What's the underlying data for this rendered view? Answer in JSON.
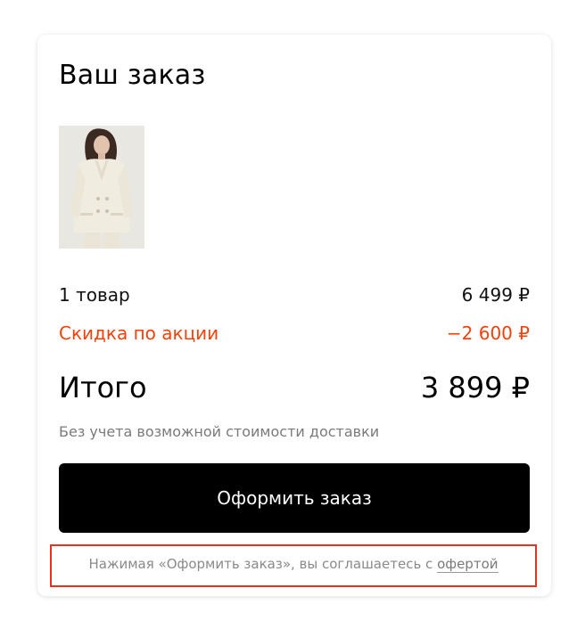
{
  "order": {
    "title": "Ваш заказ",
    "product_image_alt": "coat-photo",
    "items_label": "1 товар",
    "items_price": "6 499 ₽",
    "discount_label": "Скидка по акции",
    "discount_value": "−2 600 ₽",
    "total_label": "Итого",
    "total_value": "3 899 ₽",
    "delivery_note": "Без учета возможной стоимости доставки",
    "checkout_button": "Оформить заказ",
    "consent_text": "Нажимая «Оформить заказ», вы соглашаетесь с ",
    "offer_link": "офертой"
  },
  "colors": {
    "discount": "#f2410a",
    "button_bg": "#000000",
    "highlight_border": "#e8321c"
  }
}
